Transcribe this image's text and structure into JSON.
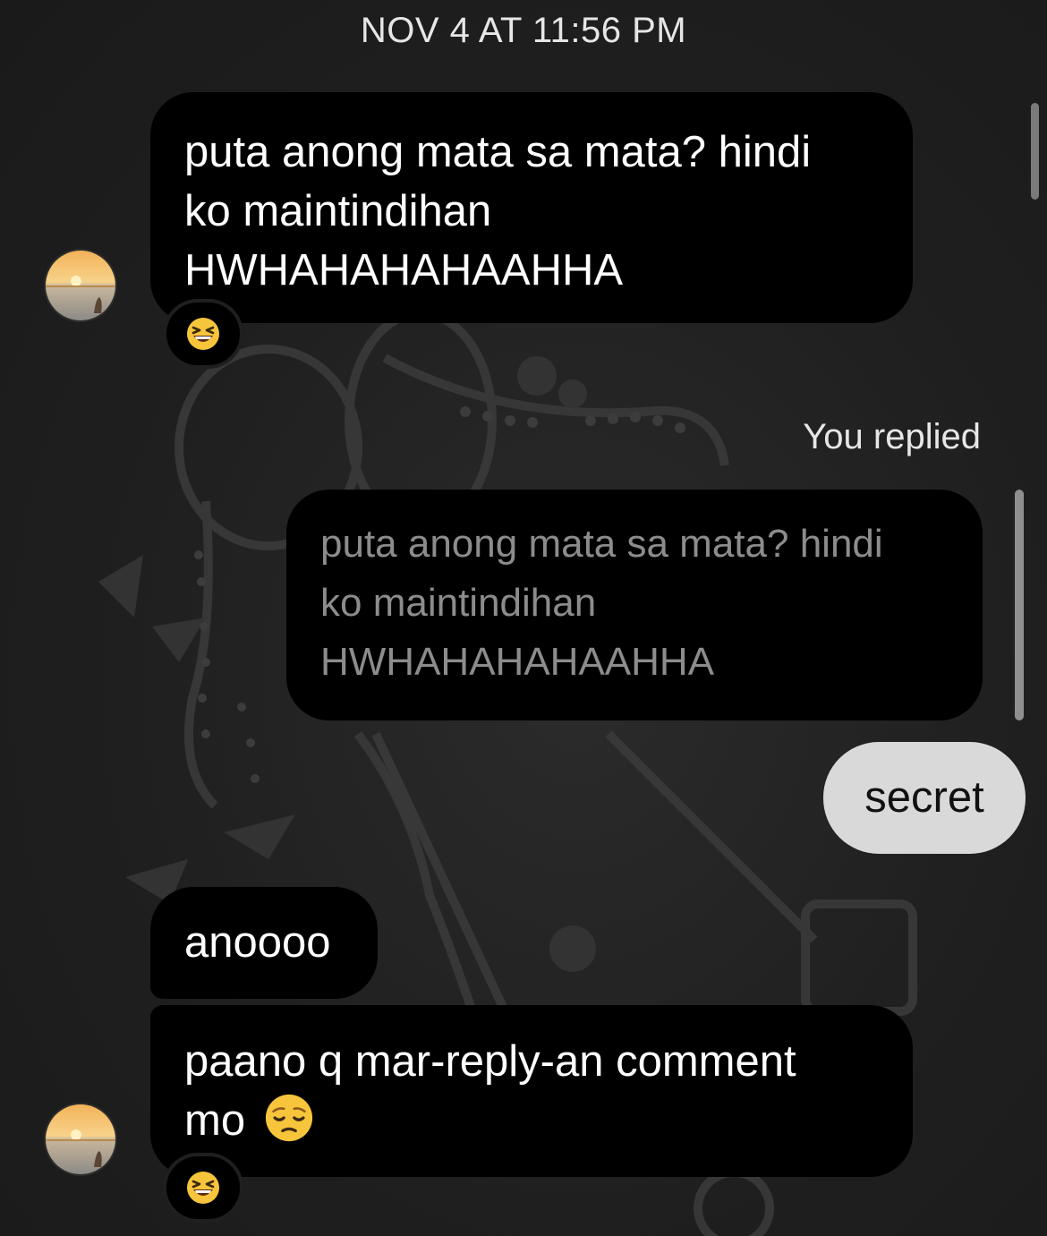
{
  "thread": {
    "timestamp": "NOV 4 AT 11:56 PM",
    "you_replied_label": "You replied"
  },
  "messages": [
    {
      "sender": "them",
      "text_lines": [
        "puta anong mata sa mata? hindi",
        "ko maintindihan",
        "HWHAHAHAHAAHHA"
      ],
      "reaction": "laughing-squint-emoji"
    },
    {
      "sender": "you",
      "quoted_lines": [
        "puta anong mata sa mata? hindi",
        "ko maintindihan",
        "HWHAHAHAHAAHHA"
      ],
      "text": "secret"
    },
    {
      "sender": "them",
      "text": "anoooo"
    },
    {
      "sender": "them",
      "text_lines": [
        "paano q mar-reply-an comment",
        "mo"
      ],
      "inline_emoji": "pensive-face-emoji",
      "reaction": "laughing-squint-emoji"
    }
  ],
  "colors": {
    "background": "#1f1f1f",
    "incoming_bubble": "#000000",
    "outgoing_bubble": "#d9d9d9",
    "quoted_text": "#8c8c8c"
  }
}
